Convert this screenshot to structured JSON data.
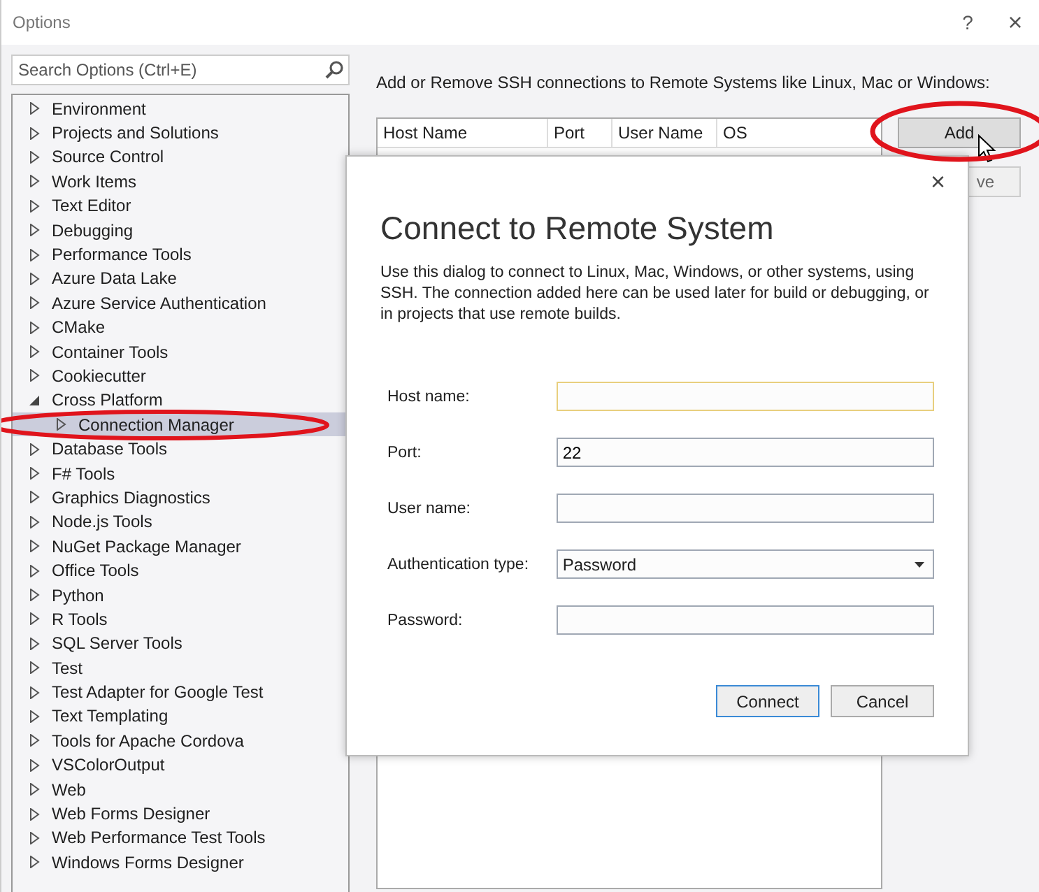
{
  "window": {
    "title": "Options",
    "help": "?",
    "close": "×"
  },
  "search": {
    "placeholder": "Search Options (Ctrl+E)"
  },
  "tree": [
    {
      "label": "Environment",
      "expanded": false
    },
    {
      "label": "Projects and Solutions",
      "expanded": false
    },
    {
      "label": "Source Control",
      "expanded": false
    },
    {
      "label": "Work Items",
      "expanded": false
    },
    {
      "label": "Text Editor",
      "expanded": false
    },
    {
      "label": "Debugging",
      "expanded": false
    },
    {
      "label": "Performance Tools",
      "expanded": false
    },
    {
      "label": "Azure Data Lake",
      "expanded": false
    },
    {
      "label": "Azure Service Authentication",
      "expanded": false
    },
    {
      "label": "CMake",
      "expanded": false
    },
    {
      "label": "Container Tools",
      "expanded": false
    },
    {
      "label": "Cookiecutter",
      "expanded": false
    },
    {
      "label": "Cross Platform",
      "expanded": true,
      "children": [
        {
          "label": "Connection Manager",
          "expanded": false,
          "selected": true
        }
      ]
    },
    {
      "label": "Database Tools",
      "expanded": false
    },
    {
      "label": "F# Tools",
      "expanded": false
    },
    {
      "label": "Graphics Diagnostics",
      "expanded": false
    },
    {
      "label": "Node.js Tools",
      "expanded": false
    },
    {
      "label": "NuGet Package Manager",
      "expanded": false
    },
    {
      "label": "Office Tools",
      "expanded": false
    },
    {
      "label": "Python",
      "expanded": false
    },
    {
      "label": "R Tools",
      "expanded": false
    },
    {
      "label": "SQL Server Tools",
      "expanded": false
    },
    {
      "label": "Test",
      "expanded": false
    },
    {
      "label": "Test Adapter for Google Test",
      "expanded": false
    },
    {
      "label": "Text Templating",
      "expanded": false
    },
    {
      "label": "Tools for Apache Cordova",
      "expanded": false
    },
    {
      "label": "VSColorOutput",
      "expanded": false
    },
    {
      "label": "Web",
      "expanded": false
    },
    {
      "label": "Web Forms Designer",
      "expanded": false
    },
    {
      "label": "Web Performance Test Tools",
      "expanded": false
    },
    {
      "label": "Windows Forms Designer",
      "expanded": false
    }
  ],
  "connections": {
    "description": "Add or Remove SSH connections to Remote Systems like Linux, Mac or Windows:",
    "columns": [
      "Host Name",
      "Port",
      "User Name",
      "OS"
    ],
    "buttons": [
      "Add",
      "ve"
    ]
  },
  "dialog": {
    "title": "Connect to Remote System",
    "close": "×",
    "description": "Use this dialog to connect to Linux, Mac, Windows, or other systems, using SSH. The connection added here can be used later for build or debugging, or in projects that use remote builds.",
    "fields": [
      {
        "label": "Host name:",
        "kind": "text",
        "focused": true
      },
      {
        "label": "Port:",
        "kind": "text",
        "value": "22",
        "focused": false
      },
      {
        "label": "User name:",
        "kind": "text",
        "focused": false
      },
      {
        "label": "Authentication type:",
        "kind": "dropdown",
        "value": "Password",
        "focused": false
      },
      {
        "label": "Password:",
        "kind": "text",
        "focused": false
      }
    ],
    "buttons": [
      {
        "label": "Connect",
        "default": true
      },
      {
        "label": "Cancel",
        "default": false
      }
    ]
  }
}
